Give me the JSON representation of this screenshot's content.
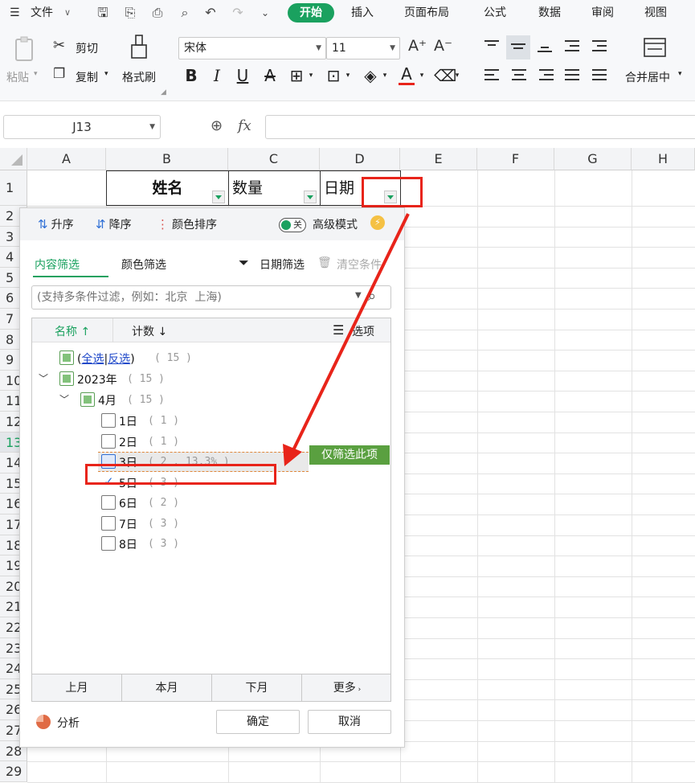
{
  "menubar": {
    "file_label": "文件",
    "tabs": [
      "开始",
      "插入",
      "页面布局",
      "公式",
      "数据",
      "审阅",
      "视图"
    ],
    "active_tab": "开始"
  },
  "ribbon": {
    "paste": "粘贴",
    "cut": "剪切",
    "copy": "复制",
    "format_painter": "格式刷",
    "font_name": "宋体",
    "font_size": "11",
    "merge_center": "合并居中"
  },
  "formula_bar": {
    "cell_ref": "J13",
    "fx_label": "fx",
    "value": ""
  },
  "sheet": {
    "columns": [
      "A",
      "B",
      "C",
      "D",
      "E",
      "F",
      "G",
      "H"
    ],
    "rows": [
      "1",
      "2",
      "3",
      "4",
      "5",
      "6",
      "7",
      "8",
      "9",
      "10",
      "11",
      "12",
      "13",
      "14",
      "15",
      "16",
      "17",
      "18",
      "19",
      "20",
      "21",
      "22",
      "23",
      "24",
      "25",
      "26",
      "27",
      "28",
      "29"
    ],
    "selected_row": "13",
    "header_cells": {
      "b1": "姓名",
      "c1": "数量",
      "d1": "日期"
    }
  },
  "filter_popup": {
    "sort_asc": "升序",
    "sort_desc": "降序",
    "sort_color": "颜色排序",
    "toggle_text": "关",
    "advanced_mode": "高级模式",
    "tab_content": "内容筛选",
    "tab_color": "颜色筛选",
    "date_filter": "日期筛选",
    "clear_conditions": "清空条件",
    "search_placeholder": "(支持多条件过滤，例如：北京  上海)",
    "col_name": "名称",
    "col_count": "计数",
    "options": "选项",
    "select_all_prefix": "(",
    "select_all": "全选",
    "separator": "|",
    "invert": "反选",
    "select_all_suffix": ")",
    "total_count": "( 15 )",
    "year": {
      "label": "2023年",
      "count": "( 15 )"
    },
    "month": {
      "label": "4月",
      "count": "( 15 )"
    },
    "days": [
      {
        "label": "1日",
        "count": "( 1 )",
        "state": "unchecked"
      },
      {
        "label": "2日",
        "count": "( 1 )",
        "state": "unchecked"
      },
      {
        "label": "3日",
        "count": "( 2 , 13.3% )",
        "state": "hover"
      },
      {
        "label": "5日",
        "count": "( 3 )",
        "state": "checked"
      },
      {
        "label": "6日",
        "count": "( 2 )",
        "state": "unchecked"
      },
      {
        "label": "7日",
        "count": "( 3 )",
        "state": "unchecked"
      },
      {
        "label": "8日",
        "count": "( 3 )",
        "state": "unchecked"
      }
    ],
    "only_this": "仅筛选此项",
    "quick": [
      "上月",
      "本月",
      "下月",
      "更多"
    ],
    "analyze": "分析",
    "ok": "确定",
    "cancel": "取消"
  },
  "colors": {
    "accent_green": "#1aa15f",
    "annotation_red": "#e8241a",
    "link_blue": "#2049c9"
  }
}
